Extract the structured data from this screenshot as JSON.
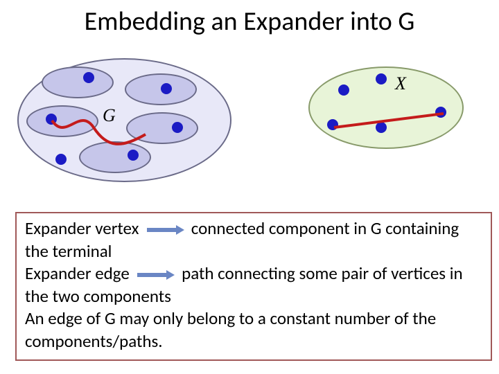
{
  "title": "Embedding an Expander into G",
  "labels": {
    "G": "G",
    "X": "X"
  },
  "box": {
    "t1a": "Expander vertex",
    "t1b": " connected component in G containing the terminal",
    "t2a": "Expander edge",
    "t2b": " path connecting some pair of vertices in the two components",
    "t3": "An edge of G may only belong to a constant number of the components/paths."
  }
}
